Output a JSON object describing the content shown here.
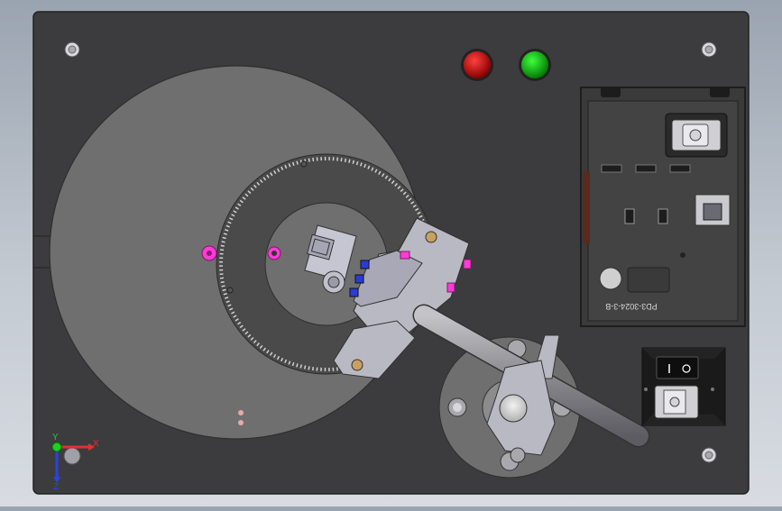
{
  "viewport": {
    "label_part": "PD3-3024-3-B",
    "triad": {
      "x_label": "X",
      "y_label": "Y",
      "z_label": "Z"
    },
    "indicators": [
      {
        "name": "red-indicator-light",
        "color": "#cc0000"
      },
      {
        "name": "green-indicator-light",
        "color": "#11bb11"
      }
    ],
    "colors": {
      "panel": "#3c3c3e",
      "disc": "#6f6f6f",
      "gear": "#4a4a4a",
      "bracket": "#b9b9c4",
      "rod": "#8e8e94",
      "magenta": "#ff3ad6",
      "blue": "#2b3bd6"
    }
  }
}
